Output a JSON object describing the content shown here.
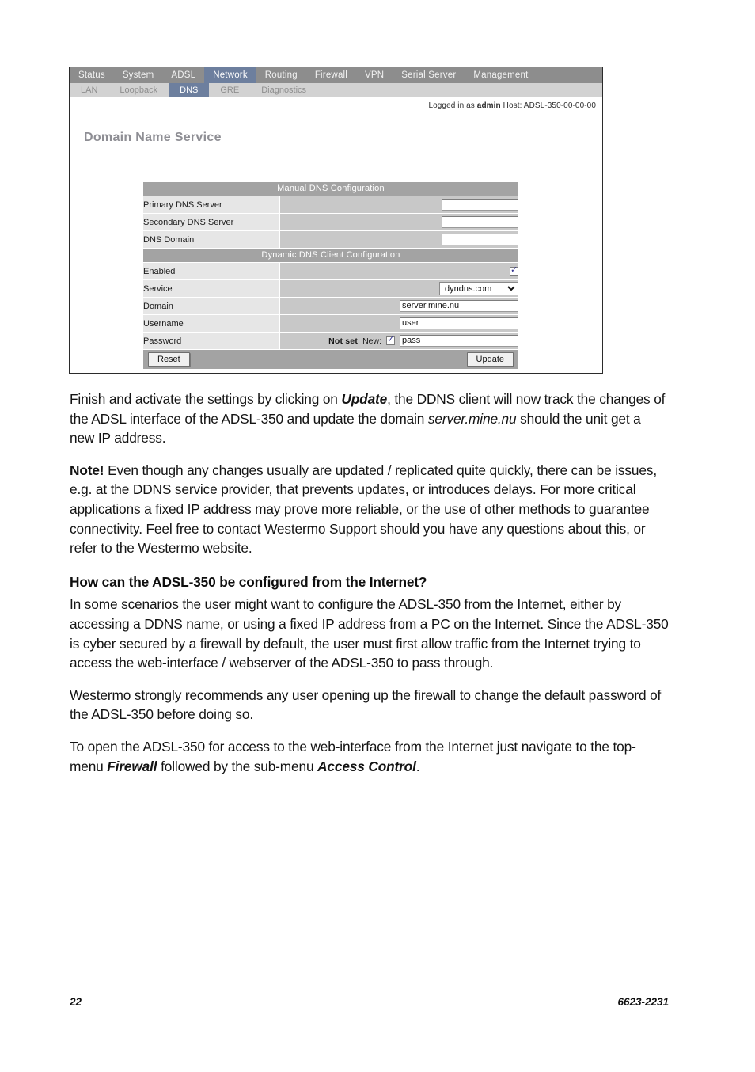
{
  "router_ui": {
    "nav_top": [
      {
        "label": "Status",
        "active": false
      },
      {
        "label": "System",
        "active": false
      },
      {
        "label": "ADSL",
        "active": false
      },
      {
        "label": "Network",
        "active": true
      },
      {
        "label": "Routing",
        "active": false
      },
      {
        "label": "Firewall",
        "active": false
      },
      {
        "label": "VPN",
        "active": false
      },
      {
        "label": "Serial Server",
        "active": false
      },
      {
        "label": "Management",
        "active": false
      }
    ],
    "nav_sub": [
      {
        "label": "LAN",
        "active": false
      },
      {
        "label": "Loopback",
        "active": false
      },
      {
        "label": "DNS",
        "active": true
      },
      {
        "label": "GRE",
        "active": false
      },
      {
        "label": "Diagnostics",
        "active": false
      }
    ],
    "login_prefix": "Logged in as ",
    "login_user": "admin",
    "login_host": " Host: ADSL-350-00-00-00",
    "page_title": "Domain Name Service",
    "sections": {
      "manual": {
        "heading": "Manual DNS Configuration",
        "rows": [
          {
            "label": "Primary DNS Server",
            "value": "",
            "placeholder": ""
          },
          {
            "label": "Secondary DNS Server",
            "value": "",
            "placeholder": ""
          },
          {
            "label": "DNS Domain",
            "value": "",
            "placeholder": ""
          }
        ]
      },
      "dynamic": {
        "heading": "Dynamic DNS Client Configuration",
        "enabled_label": "Enabled",
        "enabled_checked": true,
        "service_label": "Service",
        "service_value": "dyndns.com",
        "service_options": [
          "dyndns.com"
        ],
        "domain_label": "Domain",
        "domain_value": "server.mine.nu",
        "username_label": "Username",
        "username_value": "user",
        "password_label": "Password",
        "password_status": "Not set",
        "password_new_label": "New:",
        "password_new_checked": true,
        "password_value": "pass"
      }
    },
    "buttons": {
      "reset": "Reset",
      "update": "Update"
    },
    "colors": {
      "nav_top_bg": "#8d8d8d",
      "nav_sub_bg": "#d2d2d2",
      "active_tab": "#6d7f9e",
      "section_head_bg": "#a3a3a3",
      "row_label_bg": "#e6e6e6",
      "row_value_bg": "#c8c8c8"
    }
  },
  "document": {
    "paragraphs": [
      {
        "id": "p1",
        "parts": [
          {
            "text": "Finish and activate the settings by clicking on ",
            "style": "normal"
          },
          {
            "text": "Update",
            "style": "bold-italic"
          },
          {
            "text": ", the DDNS client will now track the changes of the ADSL interface of the ADSL-350 and update the domain ",
            "style": "normal"
          },
          {
            "text": "server.mine.nu",
            "style": "italic"
          },
          {
            "text": " should the unit get a new IP address.",
            "style": "normal"
          }
        ]
      },
      {
        "id": "p2",
        "parts": [
          {
            "text": "Note!",
            "style": "bold"
          },
          {
            "text": " Even though any changes usually are updated / replicated quite quickly, there can be issues, e.g. at the DDNS service provider, that prevents updates, or introduces delays. For more critical applications a fixed IP address may prove more reliable, or the use of other methods to guarantee connectivity. Feel free to contact Westermo Support should you have any questions about this, or refer to the Westermo website.",
            "style": "normal"
          }
        ]
      },
      {
        "id": "p3",
        "parts": [
          {
            "text": "In some scenarios the user might want to configure the ADSL-350 from the Internet, either by accessing a DDNS name, or using a fixed IP address from a PC on the Internet. Since the ADSL-350 is cyber secured by a firewall by default, the user must first allow traffic from the Internet trying to access the web-interface / webserver of the ADSL-350 to pass through.",
            "style": "normal"
          }
        ]
      },
      {
        "id": "p4",
        "parts": [
          {
            "text": "Westermo strongly recommends any user opening up the firewall to change the default password of the ADSL-350 before doing so.",
            "style": "normal"
          }
        ]
      },
      {
        "id": "p5",
        "parts": [
          {
            "text": "To open the ADSL-350 for access to the web-interface from the Internet just navigate to the top-menu ",
            "style": "normal"
          },
          {
            "text": "Firewall",
            "style": "bold-italic"
          },
          {
            "text": " followed by the sub-menu ",
            "style": "normal"
          },
          {
            "text": "Access Control",
            "style": "bold-italic"
          },
          {
            "text": ".",
            "style": "normal"
          }
        ]
      }
    ],
    "heading": "How can the ADSL-350 be configured from the Internet?"
  },
  "footer": {
    "page_number": "22",
    "doc_number": "6623-2231"
  }
}
